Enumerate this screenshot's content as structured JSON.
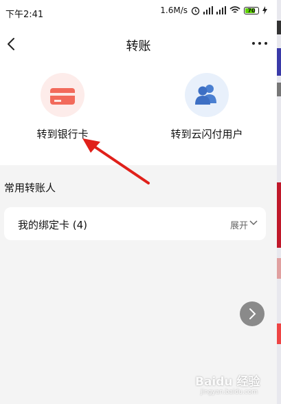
{
  "status_bar": {
    "time": "下午2:41",
    "network_speed": "1.6M/s",
    "battery": "70",
    "network_type": "4G"
  },
  "header": {
    "title": "转账"
  },
  "options": [
    {
      "label": "转到银行卡",
      "icon": "bank-card-icon"
    },
    {
      "label": "转到云闪付用户",
      "icon": "users-icon"
    }
  ],
  "section": {
    "title": "常用转账人"
  },
  "bound_cards": {
    "label": "我的绑定卡 (4)",
    "expand_label": "展开"
  },
  "watermark": {
    "brand": "Baidu 经验",
    "url": "jingyan.baidu.com"
  },
  "colors": {
    "accent_red": "#f26a5b",
    "accent_blue": "#4a7fd1",
    "arrow_red": "#e0201a"
  }
}
